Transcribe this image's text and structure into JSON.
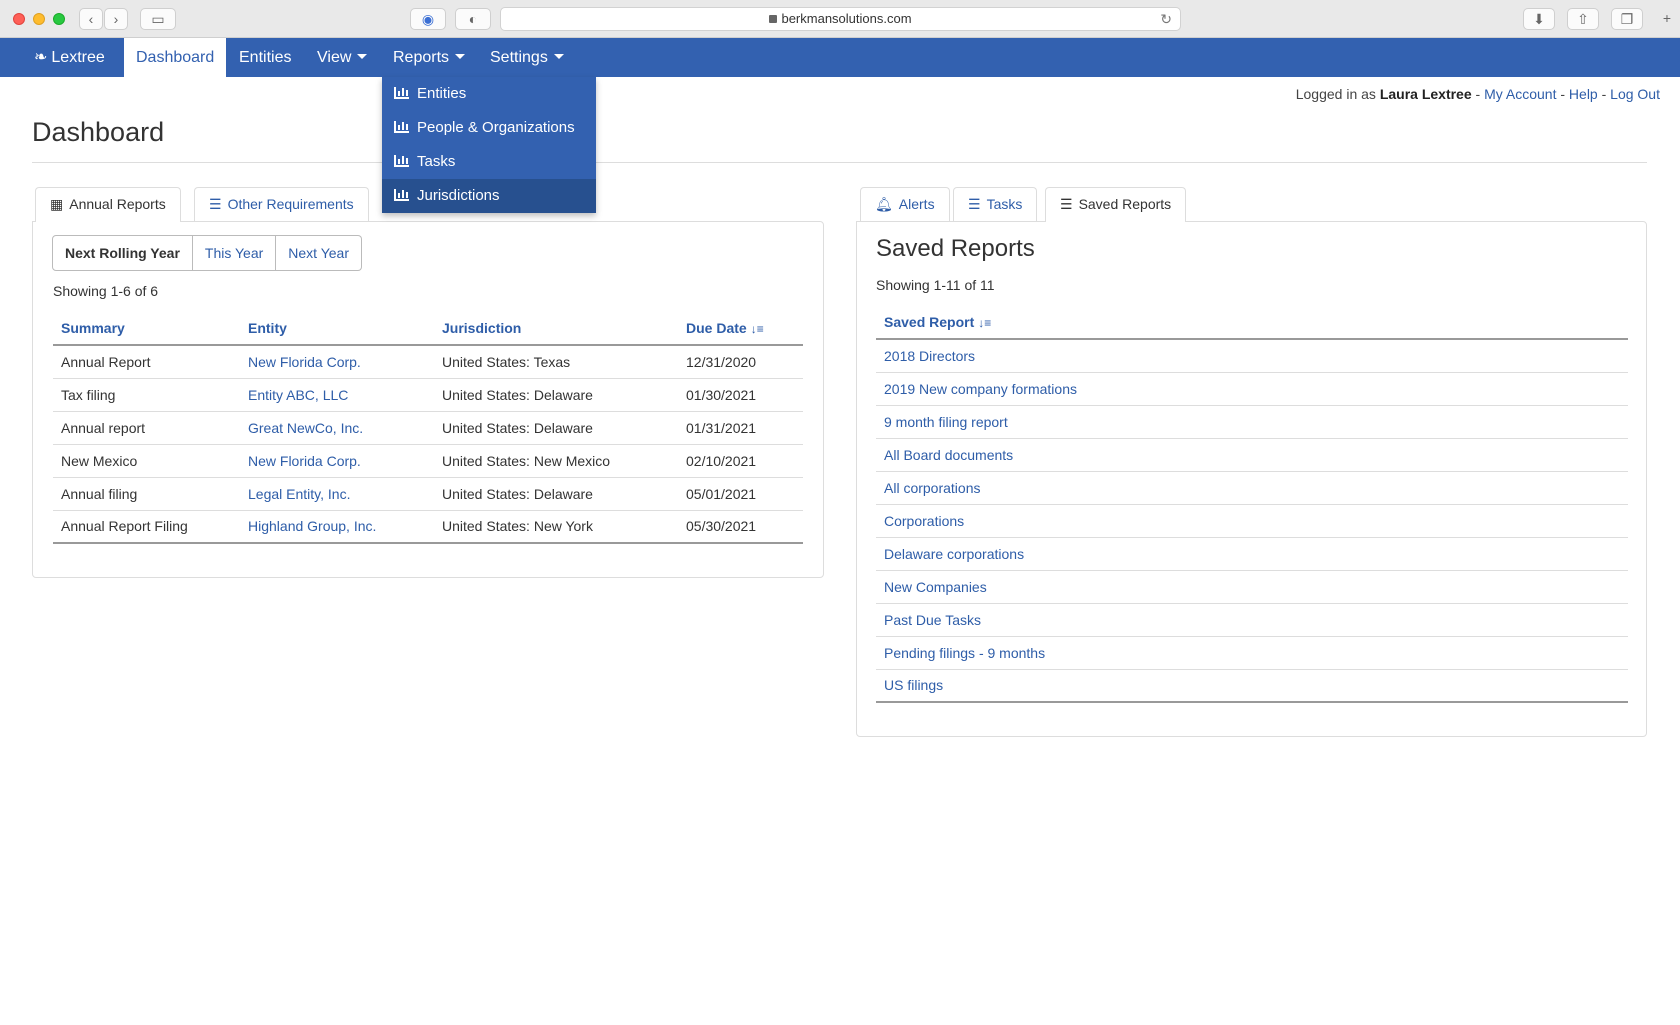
{
  "browser": {
    "url": "berkmansolutions.com"
  },
  "navbar": {
    "brand": "Lextree",
    "items": [
      {
        "label": "Dashboard"
      },
      {
        "label": "Entities"
      },
      {
        "label": "View"
      },
      {
        "label": "Reports"
      },
      {
        "label": "Settings"
      }
    ]
  },
  "reports_menu": {
    "items": [
      {
        "label": "Entities"
      },
      {
        "label": "People & Organizations"
      },
      {
        "label": "Tasks"
      },
      {
        "label": "Jurisdictions"
      }
    ]
  },
  "account": {
    "prefix": "Logged in as",
    "user": "Laura Lextree",
    "my_account": "My Account",
    "help": "Help",
    "logout": "Log Out",
    "sep": "-"
  },
  "page": {
    "title": "Dashboard"
  },
  "left_panel": {
    "tabs": [
      {
        "label": "Annual Reports"
      },
      {
        "label": "Other Requirements"
      }
    ],
    "filters": [
      {
        "label": "Next Rolling Year"
      },
      {
        "label": "This Year"
      },
      {
        "label": "Next Year"
      }
    ],
    "showing": "Showing 1-6 of 6",
    "columns": [
      "Summary",
      "Entity",
      "Jurisdiction",
      "Due Date"
    ],
    "rows": [
      {
        "summary": "Annual Report",
        "entity": "New Florida Corp.",
        "jurisdiction": "United States: Texas",
        "due": "12/31/2020"
      },
      {
        "summary": "Tax filing",
        "entity": "Entity ABC, LLC",
        "jurisdiction": "United States: Delaware",
        "due": "01/30/2021"
      },
      {
        "summary": "Annual report",
        "entity": "Great NewCo, Inc.",
        "jurisdiction": "United States: Delaware",
        "due": "01/31/2021"
      },
      {
        "summary": "New Mexico",
        "entity": "New Florida Corp.",
        "jurisdiction": "United States: New Mexico",
        "due": "02/10/2021"
      },
      {
        "summary": "Annual filing",
        "entity": "Legal Entity, Inc.",
        "jurisdiction": "United States: Delaware",
        "due": "05/01/2021"
      },
      {
        "summary": "Annual Report Filing",
        "entity": "Highland Group, Inc.",
        "jurisdiction": "United States: New York",
        "due": "05/30/2021"
      }
    ]
  },
  "right_panel": {
    "tabs": [
      {
        "label": "Alerts"
      },
      {
        "label": "Tasks"
      },
      {
        "label": "Saved Reports"
      }
    ],
    "title": "Saved Reports",
    "showing": "Showing 1-11 of 11",
    "column": "Saved Report",
    "reports": [
      "2018 Directors",
      "2019 New company formations",
      "9 month filing report",
      "All Board documents",
      "All corporations",
      "Corporations",
      "Delaware corporations",
      "New Companies",
      "Past Due Tasks",
      "Pending filings - 9 months",
      "US filings"
    ]
  },
  "colors": {
    "nav_blue": "#3361b0",
    "link_blue": "#2e5da8",
    "menu_hover": "#27508f"
  }
}
